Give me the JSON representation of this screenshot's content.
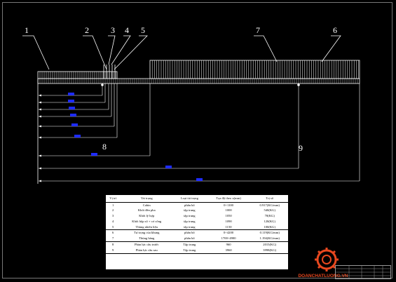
{
  "callouts": {
    "c1": "1",
    "c2": "2",
    "c3": "3",
    "c4": "4",
    "c5": "5",
    "c6": "6",
    "c7": "7",
    "c8": "8",
    "c9": "9"
  },
  "colors": {
    "background": "#000000",
    "line": "#ffffff",
    "dim_text": "#1e2cff",
    "logo": "#e8481f"
  },
  "table": {
    "headers": [
      "Vị trí",
      "Tải trọng",
      "Loại tải trọng",
      "Tọa độ theo x(mm)",
      "Trị số"
    ],
    "rows": [
      [
        "1",
        "Cabin",
        "phân bố",
        "0÷1100",
        "0.917(KG/mm)"
      ],
      [
        "2",
        "Khối đèn pha",
        "tập trung",
        "1000",
        "540(KG)"
      ],
      [
        "3",
        "Khối lý hợp",
        "tập trung",
        "1050",
        "70(KG)"
      ],
      [
        "4",
        "Khối hộp số + cơ cống",
        "tập trung",
        "1090",
        "120(KG)"
      ],
      [
        "5",
        "Thùng nhiên liệu",
        "tập trung",
        "1150",
        "100(KG)"
      ],
      [
        "6",
        "Tự trọng của khung",
        "phân bố",
        "0÷4200",
        "0.119(KG/mm)"
      ],
      [
        "7",
        "Thùng hàng",
        "phân bố",
        "1700÷4900",
        "1.194(KG/mm)"
      ],
      [
        "8",
        "Phản lực cầu trước",
        "Tập trung",
        "960",
        "2015(KG)"
      ],
      [
        "9",
        "Phản lực cầu sau",
        "Tập trung",
        "3960",
        "3998(KG)"
      ]
    ]
  },
  "logo": {
    "text": "DOANCHATLUONG.VN"
  }
}
